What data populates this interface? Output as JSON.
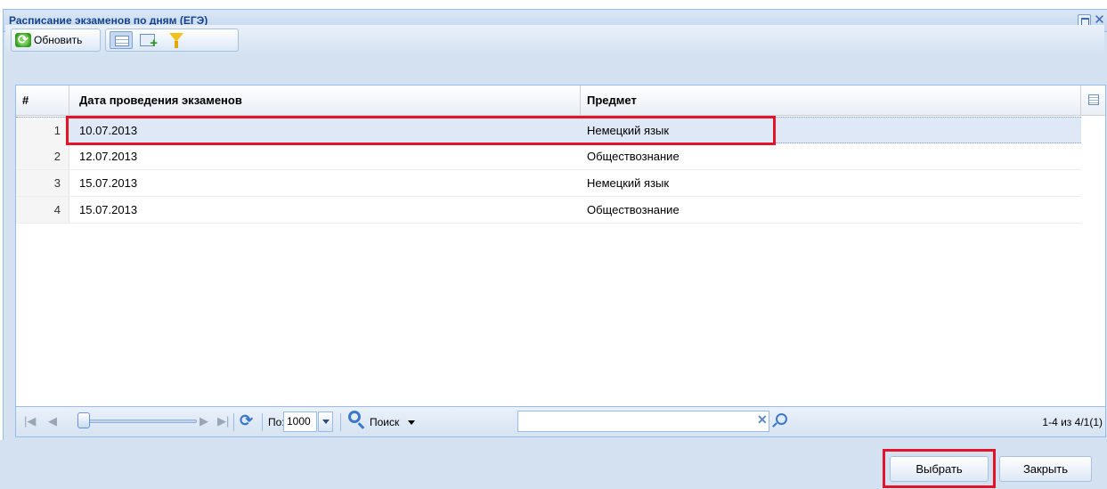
{
  "window": {
    "title": "Расписание экзаменов по дням (ЕГЭ)"
  },
  "toolbar": {
    "refresh_label": "Обновить"
  },
  "grid": {
    "columns": {
      "num": "#",
      "date": "Дата проведения экзаменов",
      "subject": "Предмет"
    },
    "rows": [
      {
        "num": "1",
        "date": "10.07.2013",
        "subject": "Немецкий язык"
      },
      {
        "num": "2",
        "date": "12.07.2013",
        "subject": "Обществознание"
      },
      {
        "num": "3",
        "date": "15.07.2013",
        "subject": "Немецкий язык"
      },
      {
        "num": "4",
        "date": "15.07.2013",
        "subject": "Обществознание"
      }
    ],
    "selected_row": 1
  },
  "pager": {
    "per_page_label": "По:",
    "per_page_value": "1000",
    "search_label": "Поиск",
    "search_value": "",
    "info": "1-4 из 4/1(1)"
  },
  "buttons": {
    "select": "Выбрать",
    "close": "Закрыть"
  },
  "colors": {
    "highlight": "#e3142a",
    "header_text": "#15428b",
    "panel_bg": "#d3e1f1"
  }
}
